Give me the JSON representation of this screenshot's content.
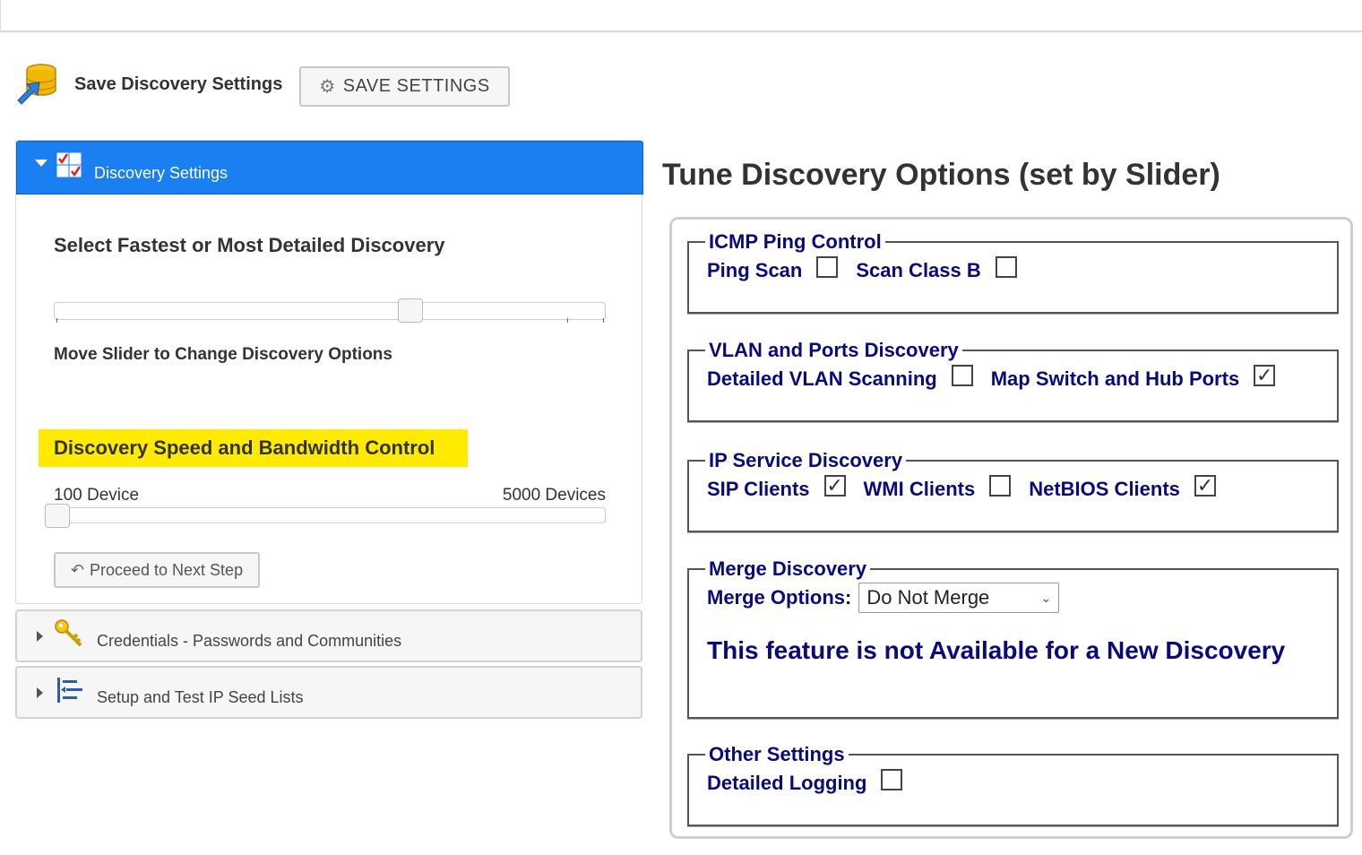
{
  "header": {
    "save_label": "Save Discovery Settings",
    "save_button": "SAVE SETTINGS"
  },
  "accordion": {
    "discovery_settings": {
      "title": "Discovery Settings",
      "section_title": "Select Fastest or Most Detailed Discovery",
      "slider_hint": "Move Slider to Change Discovery Options",
      "speed_title": "Discovery Speed and Bandwidth Control",
      "range_min": "100 Device",
      "range_max": "5000 Devices",
      "detail_slider_value": 0.67,
      "speed_slider_value": 0.0,
      "proceed_button": "Proceed to Next Step"
    },
    "credentials": {
      "title": "Credentials - Passwords and Communities"
    },
    "seed_lists": {
      "title": "Setup and Test IP Seed Lists"
    }
  },
  "tune": {
    "title": "Tune Discovery Options (set by Slider)",
    "icmp": {
      "legend": "ICMP Ping Control",
      "ping_scan": {
        "label": "Ping Scan",
        "checked": false
      },
      "scan_class_b": {
        "label": "Scan Class B",
        "checked": false
      }
    },
    "vlan": {
      "legend": "VLAN and Ports Discovery",
      "detailed_vlan": {
        "label": "Detailed VLAN Scanning",
        "checked": false
      },
      "map_switch": {
        "label": "Map Switch and Hub Ports",
        "checked": true
      }
    },
    "ip_service": {
      "legend": "IP Service Discovery",
      "sip": {
        "label": "SIP Clients",
        "checked": true
      },
      "wmi": {
        "label": "WMI Clients",
        "checked": false
      },
      "netbios": {
        "label": "NetBIOS Clients",
        "checked": true
      }
    },
    "merge": {
      "legend": "Merge Discovery",
      "options_label": "Merge Options:",
      "selected": "Do Not Merge",
      "note": "This feature is not Available for a New Discovery"
    },
    "other": {
      "legend": "Other Settings",
      "detailed_logging": {
        "label": "Detailed Logging",
        "checked": false
      }
    }
  },
  "colors": {
    "accent_blue": "#1a7ff0",
    "highlight_yellow": "#ffea00",
    "legend_navy": "#0a0a7a"
  }
}
